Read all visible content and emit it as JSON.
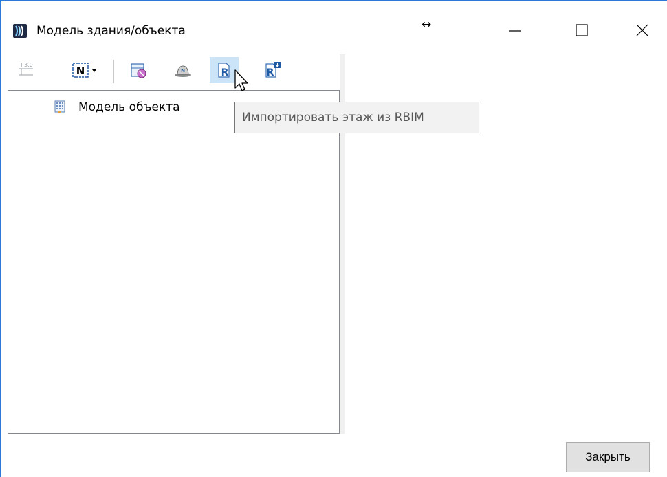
{
  "window": {
    "title": "Модель здания/объекта",
    "app_icon": "app-logo-icon",
    "controls": {
      "minimize": "minimize-icon",
      "maximize": "maximize-icon",
      "close": "close-icon",
      "resize_hint": "↔"
    }
  },
  "toolbar": {
    "buttons": [
      {
        "name": "elevation-level-button",
        "icon": "level-mark-icon",
        "label": "+3.0",
        "enabled": false
      },
      {
        "name": "north-button",
        "icon": "north-n-icon",
        "label": "N",
        "has_dropdown": true
      },
      {
        "name": "delete-floor-button",
        "icon": "floor-remove-icon"
      },
      {
        "name": "export-button",
        "icon": "hat-icon"
      },
      {
        "name": "import-rbim-floor-button",
        "icon": "import-r-icon",
        "active": true
      },
      {
        "name": "import-rbim-button",
        "icon": "import-r-down-icon"
      }
    ]
  },
  "tree": {
    "items": [
      {
        "label": "Модель объекта",
        "icon": "building-icon"
      }
    ]
  },
  "tooltip": {
    "text": "Импортировать этаж из RBIM"
  },
  "footer": {
    "close_label": "Закрыть"
  },
  "colors": {
    "accent": "#2b78d6",
    "active_bg": "#cce4f7",
    "tooltip_bg": "#f2f2f2"
  }
}
